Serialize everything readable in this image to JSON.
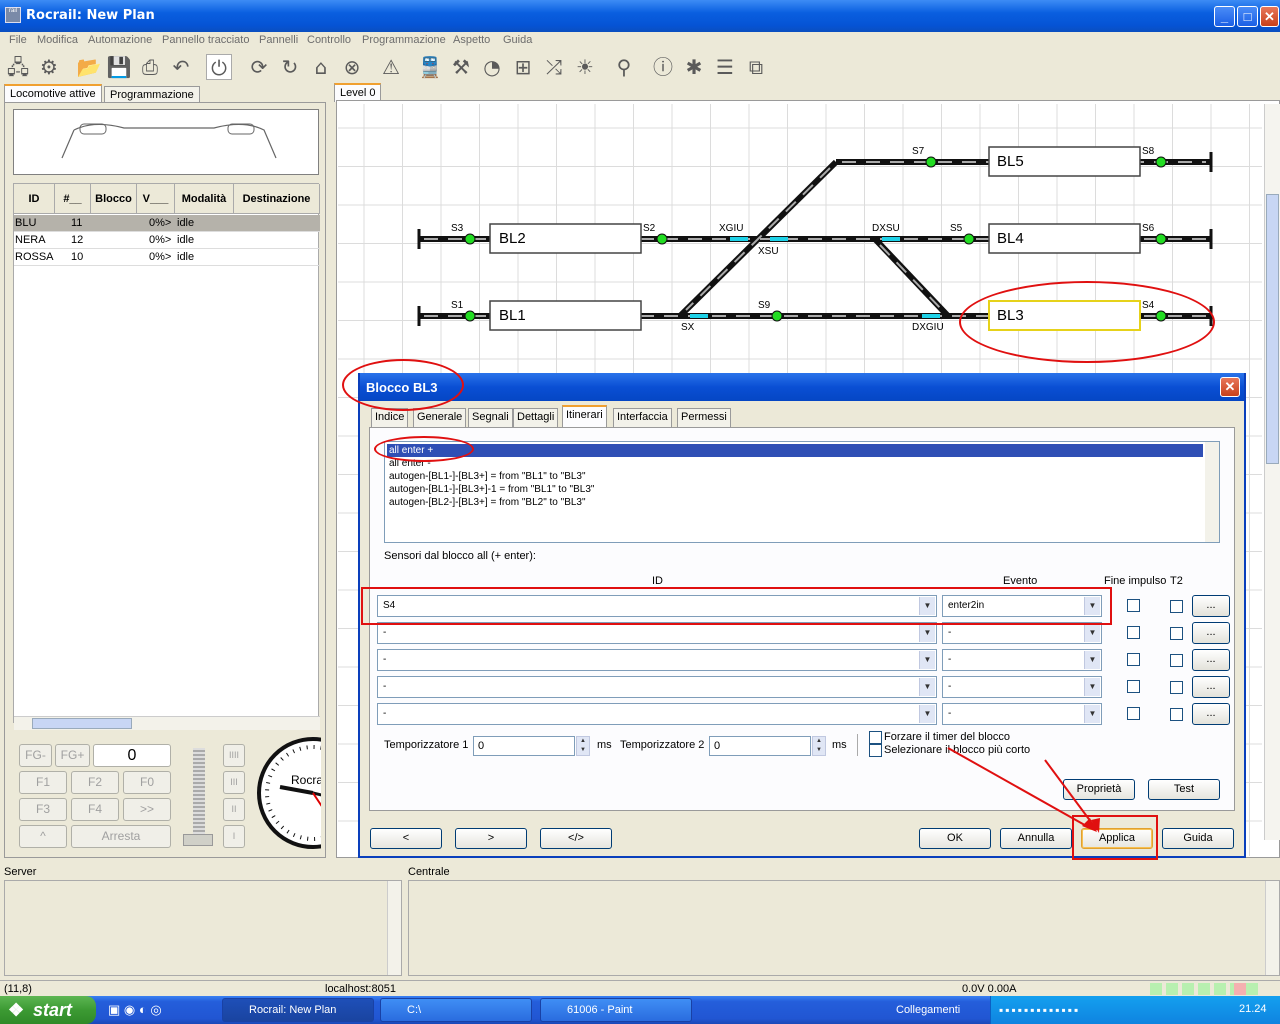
{
  "window": {
    "title": "Rocrail: New Plan",
    "app_icon": "rocrail-app-icon",
    "controls": [
      "minimize-icon",
      "maximize-icon",
      "close-icon"
    ]
  },
  "menu": [
    "File",
    "Modifica",
    "Automazione",
    "Pannello tracciato",
    "Pannelli",
    "Controllo",
    "Programmazione",
    "Aspetto",
    "Guida"
  ],
  "toolbar_icons": [
    "network-icon",
    "gear-icon",
    "open-folder-icon",
    "save-icon",
    "print-icon",
    "undo-icon",
    "power-icon",
    "sync-icon",
    "refresh-icon",
    "home-icon",
    "stop-icon",
    "warning-icon",
    "train-icon",
    "train-dispatch-icon",
    "speedometer-icon",
    "switchboard-icon",
    "shuffle-icon",
    "light-icon",
    "zoom-icon",
    "info-icon",
    "bug-icon",
    "document-icon",
    "pages-icon"
  ],
  "left_tabs": {
    "tab1": "Locomotive attive",
    "tab2": "Programmazione"
  },
  "loco_table": {
    "headers": [
      "ID",
      "#__",
      "Blocco",
      "V___",
      "Modalità",
      "Destinazione"
    ],
    "rows": [
      {
        "id": "BLU",
        "num": "11",
        "block": "",
        "v": "0%>",
        "mode": "idle",
        "dest": ""
      },
      {
        "id": "NERA",
        "num": "12",
        "block": "",
        "v": "0%>",
        "mode": "idle",
        "dest": ""
      },
      {
        "id": "ROSSA",
        "num": "10",
        "block": "",
        "v": "0%>",
        "mode": "idle",
        "dest": ""
      }
    ]
  },
  "throttle": {
    "fg": "FG-",
    "fgplus": "FG+",
    "speed": "0",
    "f1": "F1",
    "f2": "F2",
    "f0": "F0",
    "f3": "F3",
    "f4": "F4",
    "more": ">>",
    "up": "^",
    "stop": "Arresta",
    "levels": [
      "IIII",
      "III",
      "II",
      "I"
    ],
    "clock_label": "Rocrail"
  },
  "level_tab": "Level 0",
  "plan": {
    "blocks": [
      "BL5",
      "BL2",
      "BL4",
      "BL1",
      "BL3"
    ],
    "sensors": [
      "S7",
      "S8",
      "S3",
      "S2",
      "S5",
      "S6",
      "S1",
      "S9",
      "S4"
    ],
    "switches": [
      "XGIU",
      "XSU",
      "DXSU",
      "SX",
      "DXGIU"
    ]
  },
  "dialog": {
    "title": "Blocco BL3",
    "tabs": [
      "Indice",
      "Generale",
      "Segnali",
      "Dettagli",
      "Itinerari",
      "Interfaccia",
      "Permessi"
    ],
    "routes": [
      "all enter +",
      "all enter -",
      "autogen-[BL1-]-[BL3+] = from \"BL1\" to \"BL3\"",
      "autogen-[BL1-]-[BL3+]-1 = from \"BL1\" to \"BL3\"",
      "autogen-[BL2-]-[BL3+] = from \"BL2\" to \"BL3\""
    ],
    "sensors_label": "Sensori dal blocco all (+ enter):",
    "col_id": "ID",
    "col_event": "Evento",
    "col_pulse": "Fine impulso",
    "col_t2": "T2",
    "sensor_rows": [
      {
        "id": "S4",
        "event": "enter2in"
      },
      {
        "id": "-",
        "event": "-"
      },
      {
        "id": "-",
        "event": "-"
      },
      {
        "id": "-",
        "event": "-"
      },
      {
        "id": "-",
        "event": "-"
      }
    ],
    "dots_label": "...",
    "timer1_label": "Temporizzatore 1",
    "timer1_value": "0",
    "timer2_label": "Temporizzatore 2",
    "timer2_value": "0",
    "ms": "ms",
    "force_timer": "Forzare il timer del blocco",
    "select_shortest": "Selezionare il blocco più corto",
    "btn_props": "Proprietà",
    "btn_test": "Test",
    "btn_prev": "<",
    "btn_next": ">",
    "btn_xml": "</>",
    "btn_ok": "OK",
    "btn_cancel": "Annulla",
    "btn_apply": "Applica",
    "btn_help": "Guida"
  },
  "bottom": {
    "server": "Server",
    "central": "Centrale"
  },
  "status": {
    "coords": "(11,8)",
    "host": "localhost:8051",
    "power": "0.0V 0.00A"
  },
  "taskbar": {
    "start": "start",
    "tasks": [
      "Rocrail: New Plan",
      "C:\\",
      "61006 - Paint"
    ],
    "links": "Collegamenti",
    "clock": "21.24"
  },
  "colors": {
    "annotation_red": "#e01010",
    "titlebar_blue": "#0a5fe0",
    "sensor_green": "#22dd22",
    "switch_cyan": "#1ed2e8"
  }
}
